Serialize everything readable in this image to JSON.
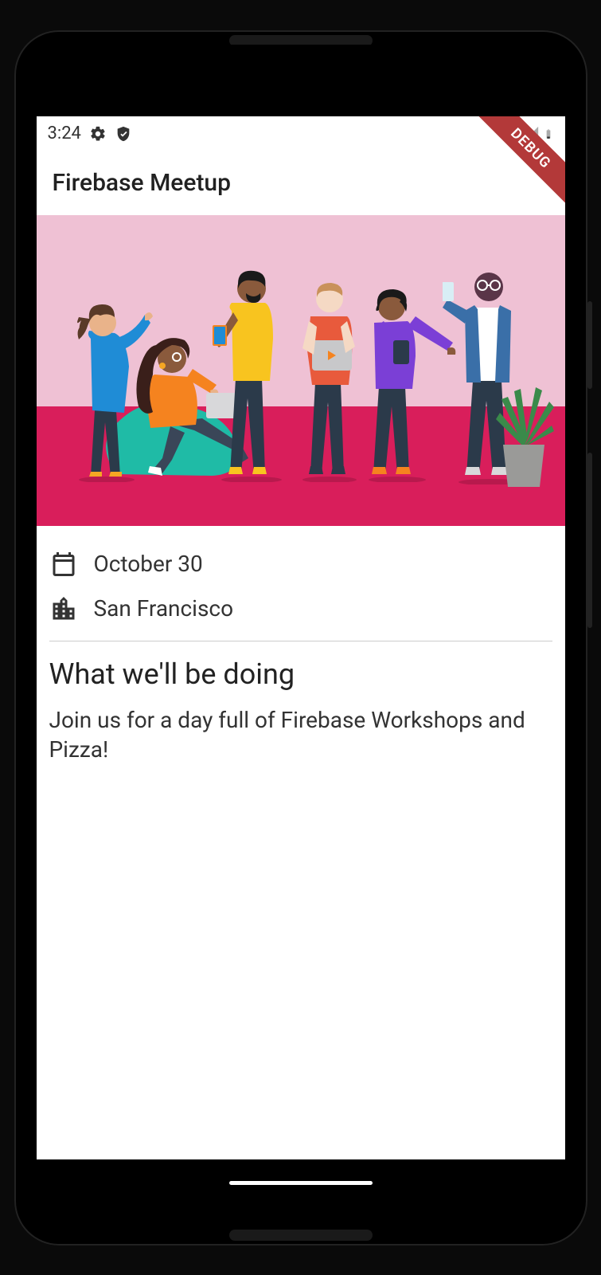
{
  "status_bar": {
    "time": "3:24",
    "icons": [
      "gear",
      "shield",
      "wifi",
      "signal",
      "battery"
    ]
  },
  "debug_label": "DEBUG",
  "app_bar": {
    "title": "Firebase Meetup"
  },
  "event": {
    "date": "October 30",
    "location": "San Francisco"
  },
  "section": {
    "heading": "What we'll be doing",
    "body": "Join us for a day full of Firebase Workshops and Pizza!"
  },
  "colors": {
    "hero_bg": "#d91e5b",
    "hero_pink": "#efc1d4",
    "beanbag": "#1fbba6"
  }
}
